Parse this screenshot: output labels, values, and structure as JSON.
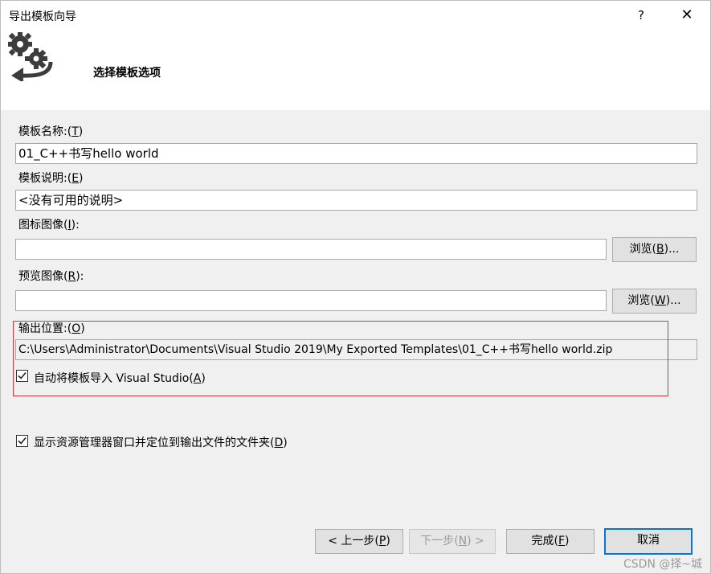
{
  "window": {
    "title": "导出模板向导",
    "help_glyph": "?",
    "close_glyph": "✕",
    "icon": "gears-arrow-icon"
  },
  "step_title": "选择模板选项",
  "fields": {
    "template_name": {
      "label": "模板名称:",
      "mnemonic": "T",
      "value": "01_C++书写hello world"
    },
    "template_desc": {
      "label": "模板说明:",
      "mnemonic": "E",
      "value": "<没有可用的说明>"
    },
    "icon_image": {
      "label": "图标图像",
      "mnemonic": "I",
      "label_suffix": ":",
      "value": "",
      "browse": "浏览",
      "browse_mnemonic": "B",
      "browse_suffix": "..."
    },
    "preview_image": {
      "label": "预览图像",
      "mnemonic": "R",
      "label_suffix": ":",
      "value": "",
      "browse": "浏览",
      "browse_mnemonic": "W",
      "browse_suffix": "..."
    },
    "output_location": {
      "label": "输出位置:",
      "mnemonic": "O",
      "value": "C:\\Users\\Administrator\\Documents\\Visual Studio 2019\\My Exported Templates\\01_C++书写hello world.zip"
    }
  },
  "checkboxes": {
    "auto_import": {
      "label": "自动将模板导入 Visual Studio",
      "mnemonic": "A",
      "checked": true
    },
    "open_explorer": {
      "label": "显示资源管理器窗口并定位到输出文件的文件夹",
      "mnemonic": "D",
      "checked": true
    }
  },
  "buttons": {
    "prev": {
      "prefix": "< 上一步",
      "mnemonic": "P",
      "suffix": ""
    },
    "next": {
      "prefix": "下一步",
      "mnemonic": "N",
      "suffix": " >"
    },
    "finish": {
      "prefix": "完成",
      "mnemonic": "F",
      "suffix": ""
    },
    "cancel": {
      "label": "取消"
    }
  },
  "watermark": "CSDN @择~城",
  "colors": {
    "highlight": "#e0323c",
    "default_button": "#0078d7"
  }
}
